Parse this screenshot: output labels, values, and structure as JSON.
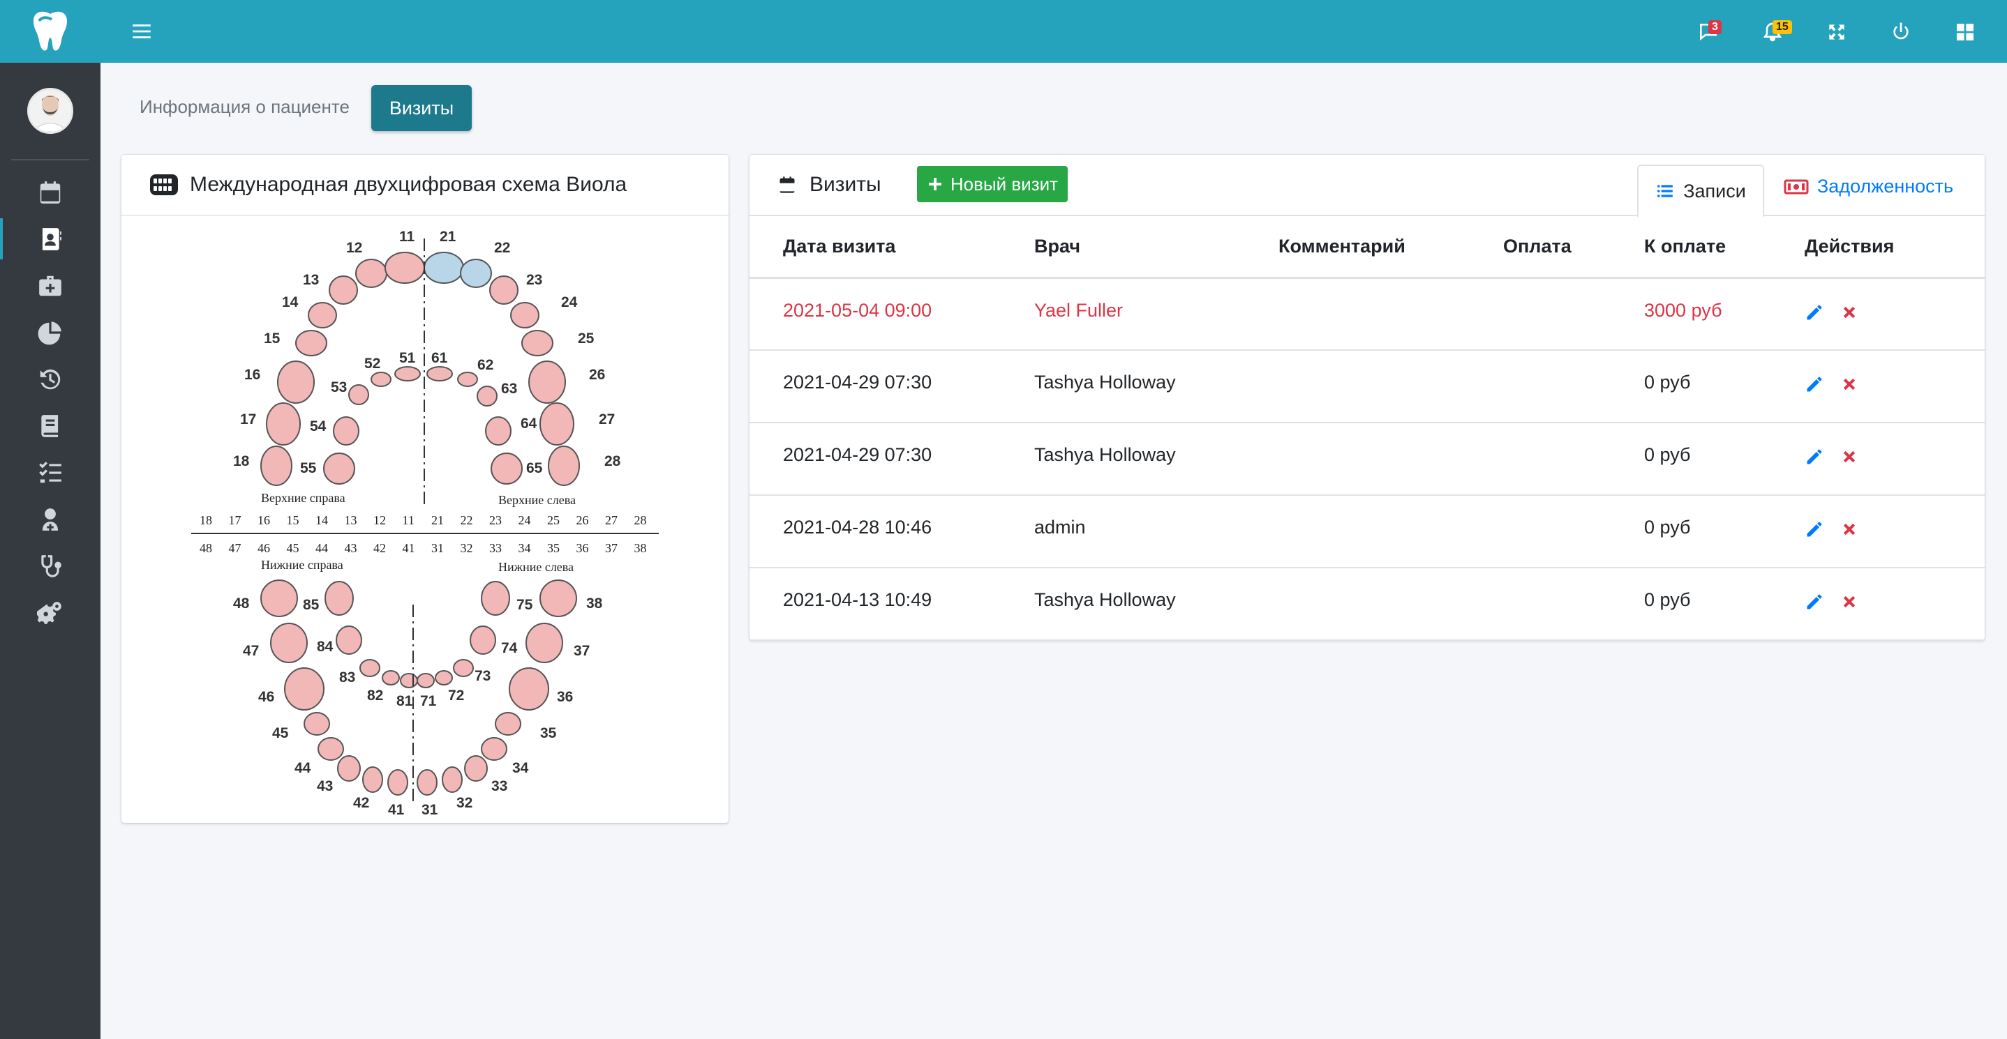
{
  "topbar": {
    "messages_count": "3",
    "notifications_count": "15"
  },
  "page_tabs": {
    "info": "Информация о пациенте",
    "visits": "Визиты"
  },
  "tooth_chart": {
    "title": "Международная двухцифровая схема Виола",
    "upper_right_label": "Верхние справа",
    "upper_left_label": "Верхние слева",
    "lower_right_label": "Нижние справа",
    "lower_left_label": "Нижние слева",
    "row_upper": [
      "18",
      "17",
      "16",
      "15",
      "14",
      "13",
      "12",
      "11",
      "21",
      "22",
      "23",
      "24",
      "25",
      "26",
      "27",
      "28"
    ],
    "row_lower": [
      "48",
      "47",
      "46",
      "45",
      "44",
      "43",
      "42",
      "41",
      "31",
      "32",
      "33",
      "34",
      "35",
      "36",
      "37",
      "38"
    ],
    "highlight_color": "#b9d6e8",
    "tooth_color": "#f2b8b8"
  },
  "visits_card": {
    "title": "Визиты",
    "new_visit_label": "Новый визит",
    "tabs": {
      "records": "Записи",
      "debt": "Задолженность"
    },
    "columns": [
      "Дата визита",
      "Врач",
      "Комментарий",
      "Оплата",
      "К оплате",
      "Действия"
    ],
    "rows": [
      {
        "date": "2021-05-04 09:00",
        "doctor": "Yael Fuller",
        "comment": "",
        "payment": "",
        "due": "3000 руб",
        "danger": true
      },
      {
        "date": "2021-04-29 07:30",
        "doctor": "Tashya Holloway",
        "comment": "",
        "payment": "",
        "due": "0 руб",
        "danger": false
      },
      {
        "date": "2021-04-29 07:30",
        "doctor": "Tashya Holloway",
        "comment": "",
        "payment": "",
        "due": "0 руб",
        "danger": false
      },
      {
        "date": "2021-04-28 10:46",
        "doctor": "admin",
        "comment": "",
        "payment": "",
        "due": "0 руб",
        "danger": false
      },
      {
        "date": "2021-04-13 10:49",
        "doctor": "Tashya Holloway",
        "comment": "",
        "payment": "",
        "due": "0 руб",
        "danger": false
      }
    ]
  },
  "colors": {
    "brand": "#25a3bd",
    "sidebar": "#343a40",
    "active_tab": "#1c7a8c",
    "success": "#28a745",
    "danger": "#dc3545",
    "link": "#007bff"
  }
}
